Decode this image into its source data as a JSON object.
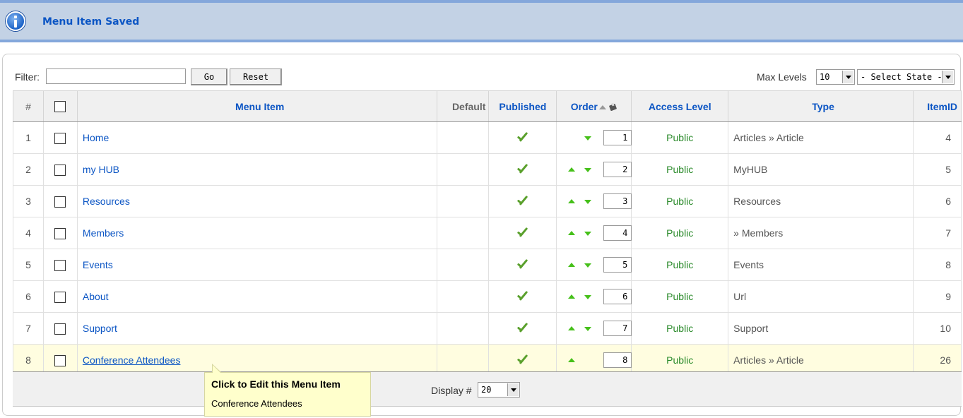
{
  "message": {
    "text": "Menu Item Saved",
    "icon": "info-icon"
  },
  "filter": {
    "label": "Filter:",
    "value": "",
    "go_label": "Go",
    "reset_label": "Reset"
  },
  "max_levels": {
    "label": "Max Levels",
    "value": "10"
  },
  "state_select": {
    "value": "- Select State -"
  },
  "table": {
    "headers": {
      "num": "#",
      "menu_item": "Menu Item",
      "default": "Default",
      "published": "Published",
      "order": "Order",
      "access": "Access Level",
      "type": "Type",
      "itemid": "ItemID"
    },
    "rows": [
      {
        "num": "1",
        "title": "Home",
        "published": true,
        "order": "1",
        "access": "Public",
        "type": "Articles » Article",
        "itemid": "4"
      },
      {
        "num": "2",
        "title": "my HUB",
        "published": true,
        "order": "2",
        "access": "Public",
        "type": "MyHUB",
        "itemid": "5"
      },
      {
        "num": "3",
        "title": "Resources",
        "published": true,
        "order": "3",
        "access": "Public",
        "type": "Resources",
        "itemid": "6"
      },
      {
        "num": "4",
        "title": "Members",
        "published": true,
        "order": "4",
        "access": "Public",
        "type": "» Members",
        "itemid": "7"
      },
      {
        "num": "5",
        "title": "Events",
        "published": true,
        "order": "5",
        "access": "Public",
        "type": "Events",
        "itemid": "8"
      },
      {
        "num": "6",
        "title": "About",
        "published": true,
        "order": "6",
        "access": "Public",
        "type": "Url",
        "itemid": "9"
      },
      {
        "num": "7",
        "title": "Support",
        "published": true,
        "order": "7",
        "access": "Public",
        "type": "Support",
        "itemid": "10"
      },
      {
        "num": "8",
        "title": "Conference Attendees",
        "published": true,
        "order": "8",
        "access": "Public",
        "type": "Articles » Article",
        "itemid": "26"
      }
    ]
  },
  "footer": {
    "display_label": "Display #",
    "display_value": "20"
  },
  "tooltip": {
    "title": "Click to Edit this Menu Item",
    "body": "Conference Attendees"
  },
  "colors": {
    "link": "#0b55c4",
    "access": "#2a8a2a",
    "arrow": "#46c01a",
    "message_bg": "#c3d2e5",
    "highlight_row": "#fffde0"
  }
}
